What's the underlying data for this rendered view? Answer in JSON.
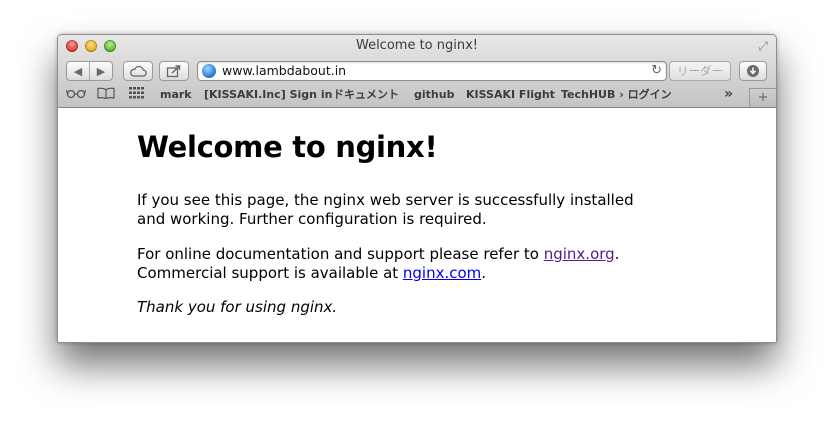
{
  "window": {
    "title": "Welcome to nginx!"
  },
  "toolbar": {
    "back_glyph": "◀",
    "forward_glyph": "▶",
    "url": "www.lambdabout.in",
    "reader_label": "リーダー",
    "icons": [
      "back-icon",
      "forward-icon",
      "icloud-icon",
      "share-icon",
      "globe-icon",
      "reload-icon",
      "download-icon"
    ]
  },
  "bookmarks": {
    "items": [
      {
        "label": "mark"
      },
      {
        "label": "[KISSAKI.Inc] Sign in"
      },
      {
        "label": "ドキュメント"
      },
      {
        "label": "github"
      },
      {
        "label": "KISSAKI Flight"
      },
      {
        "label": "TechHUB › ログイン"
      }
    ],
    "more_glyph": "»",
    "new_tab_glyph": "+"
  },
  "page": {
    "heading": "Welcome to nginx!",
    "p1": "If you see this page, the nginx web server is successfully installed and working. Further configuration is required.",
    "p2_before": "For online documentation and support please refer to ",
    "p2_link1": "nginx.org",
    "p2_middle": ".",
    "p2_line2_before": "Commercial support is available at ",
    "p2_link2": "nginx.com",
    "p2_end": ".",
    "p3": "Thank you for using nginx."
  },
  "colors": {
    "link": "#0000ee",
    "visited_link": "#551a8b"
  }
}
